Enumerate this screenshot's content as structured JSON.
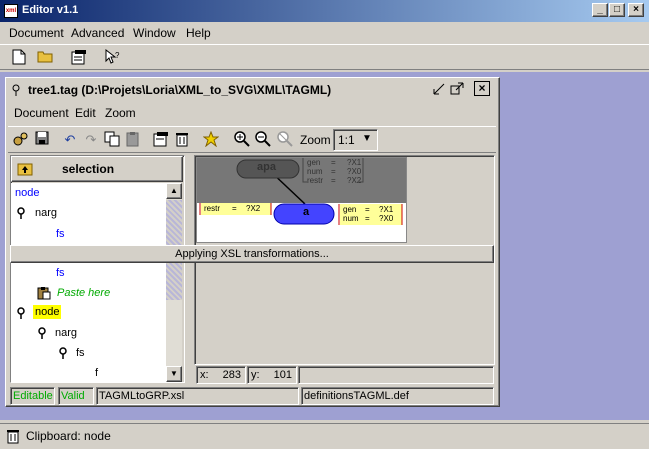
{
  "window": {
    "title": "Editor v1.1",
    "app_icon": "editor-logo-icon"
  },
  "menubar": [
    {
      "label": "Document",
      "mnemonic": "D"
    },
    {
      "label": "Advanced",
      "mnemonic": "A"
    },
    {
      "label": "Window",
      "mnemonic": "W"
    },
    {
      "label": "Help",
      "mnemonic": "H"
    }
  ],
  "main_toolbar": [
    "new-document-icon",
    "open-folder-icon",
    "properties-icon",
    "context-help-icon"
  ],
  "doc": {
    "title": "tree1.tag  (D:\\Projets\\Loria\\XML_to_SVG\\XML\\TAGML)",
    "menu": [
      {
        "label": "Document"
      },
      {
        "label": "Edit"
      },
      {
        "label": "Zoom"
      }
    ],
    "toolbar": {
      "zoom_label": "Zoom",
      "zoom_value": "1:1"
    },
    "selection_label": "selection",
    "tree": [
      {
        "text": "node",
        "style": "blue"
      },
      {
        "text": "narg",
        "style": "normal"
      },
      {
        "text": "fs",
        "style": "blue"
      },
      {
        "text": "fs",
        "style": "blue"
      },
      {
        "text": "Paste here",
        "style": "green-italic"
      },
      {
        "text": "node",
        "style": "highlight"
      },
      {
        "text": "narg",
        "style": "normal"
      },
      {
        "text": "fs",
        "style": "normal"
      },
      {
        "text": "f",
        "style": "normal"
      }
    ],
    "canvas": {
      "top_node": "apa",
      "top_features": [
        [
          "gen",
          "=",
          "?X1"
        ],
        [
          "num",
          "=",
          "?X0"
        ],
        [
          "restr",
          "=",
          "?X2"
        ]
      ],
      "left_features": [
        [
          "restr",
          "=",
          "?X2"
        ]
      ],
      "bottom_node": "a",
      "right_features": [
        [
          "gen",
          "=",
          "?X1"
        ],
        [
          "num",
          "=",
          "?X0"
        ]
      ]
    },
    "progress_text": "Applying XSL transformations...",
    "coords": {
      "x_label": "x:",
      "x_value": "283",
      "y_label": "y:",
      "y_value": "101"
    },
    "status": {
      "editable": "Editable",
      "valid": "Valid",
      "xsl_file": "TAGMLtoGRP.xsl",
      "def_file": "definitionsTAGML.def"
    }
  },
  "bottom": {
    "clipboard_label": "Clipboard:",
    "clipboard_value": "node"
  },
  "colors": {
    "desktop": "#9ea0d2",
    "title_active": "#0a246a",
    "node_blue": "#4444ff",
    "node_grey": "#777777",
    "feature_yellow": "#ffff99",
    "selection_yellow": "#ffff00"
  }
}
